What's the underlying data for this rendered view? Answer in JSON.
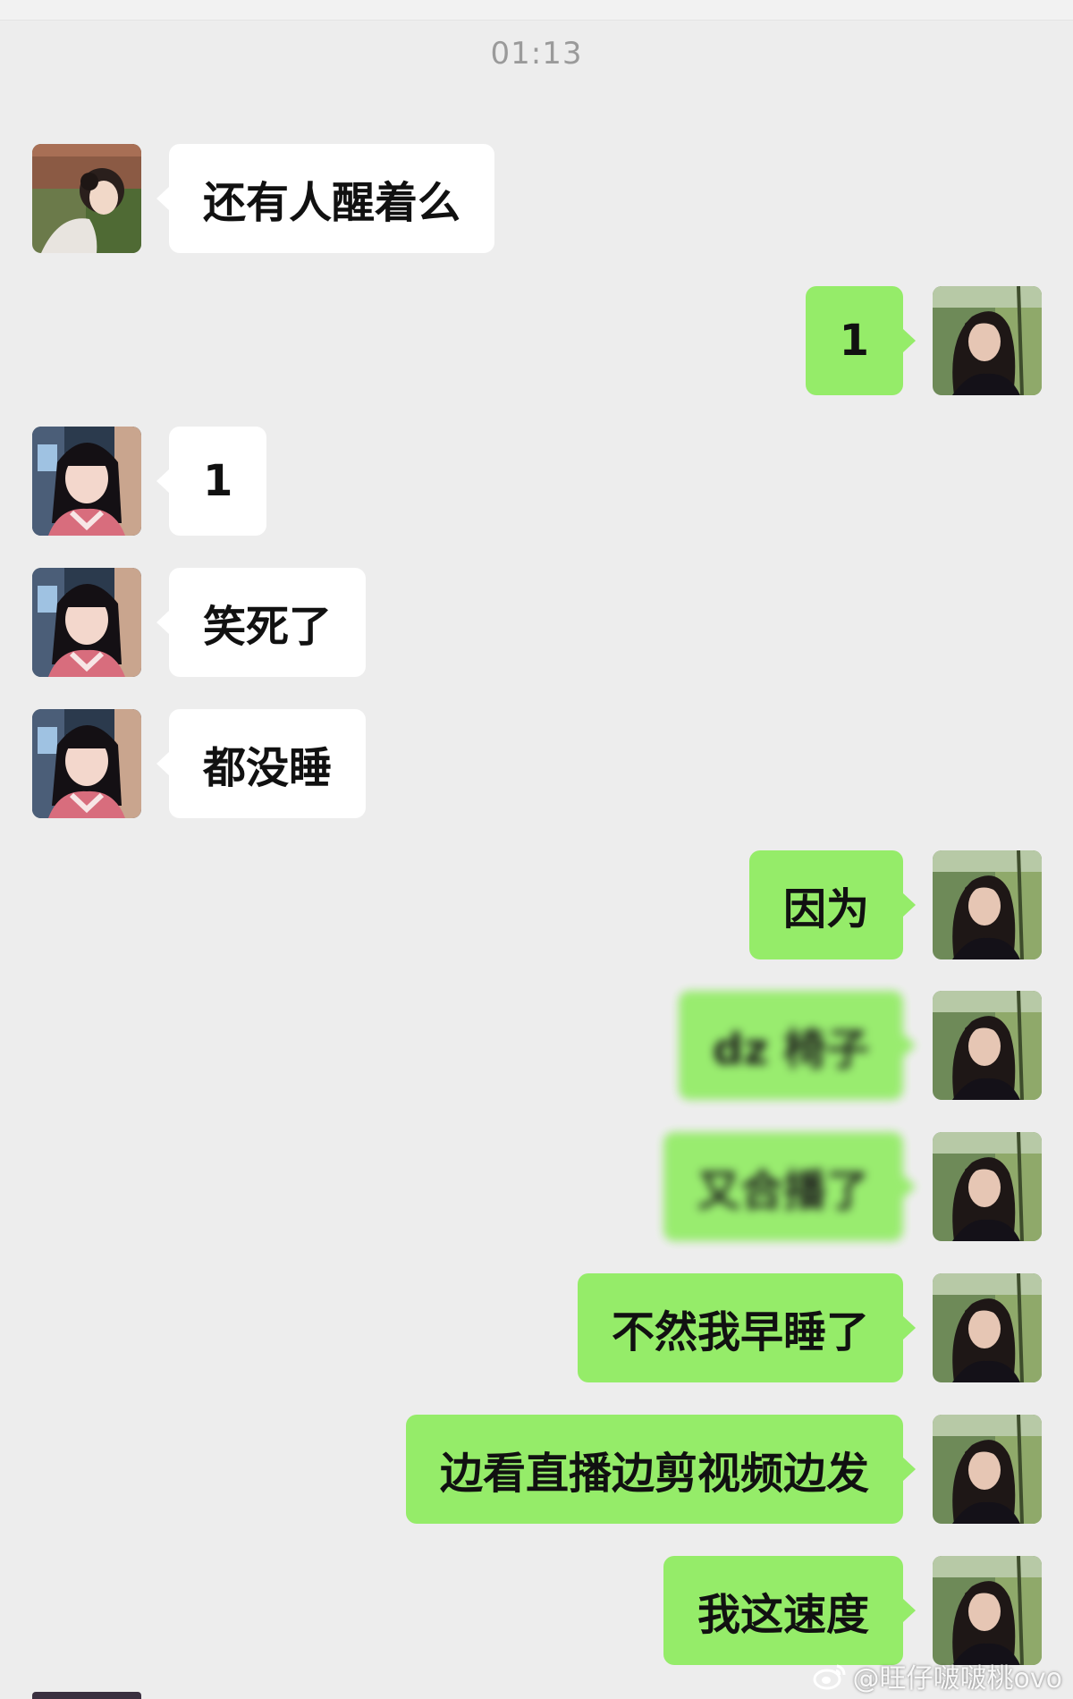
{
  "timestamp": "01:13",
  "messages": [
    {
      "side": "left",
      "avatar": "girl-avatar-a",
      "text": "还有人醒着么",
      "blurred": false
    },
    {
      "side": "right",
      "avatar": "self-avatar",
      "text": "1",
      "blurred": false
    },
    {
      "side": "left",
      "avatar": "girl-avatar-b",
      "text": "1",
      "blurred": false
    },
    {
      "side": "left",
      "avatar": "girl-avatar-b",
      "text": "笑死了",
      "blurred": false
    },
    {
      "side": "left",
      "avatar": "girl-avatar-b",
      "text": "都没睡",
      "blurred": false
    },
    {
      "side": "right",
      "avatar": "self-avatar",
      "text": "因为",
      "blurred": false
    },
    {
      "side": "right",
      "avatar": "self-avatar",
      "text": "dz 椅子",
      "blurred": true
    },
    {
      "side": "right",
      "avatar": "self-avatar",
      "text": "又合播了",
      "blurred": true
    },
    {
      "side": "right",
      "avatar": "self-avatar",
      "text": "不然我早睡了",
      "blurred": false
    },
    {
      "side": "right",
      "avatar": "self-avatar",
      "text": "边看直播边剪视频边发",
      "blurred": false
    },
    {
      "side": "right",
      "avatar": "self-avatar",
      "text": "我这速度",
      "blurred": false
    }
  ],
  "watermark": "@旺仔啵啵桃ovo",
  "colors": {
    "background": "#ededed",
    "bubble_left": "#ffffff",
    "bubble_right": "#95ec69",
    "timestamp": "#9a9a9a"
  }
}
